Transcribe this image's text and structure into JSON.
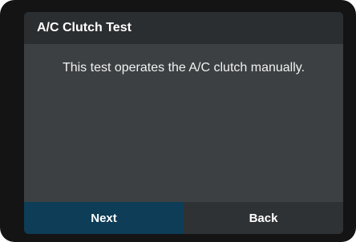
{
  "dialog": {
    "title": "A/C Clutch Test",
    "message": "This test operates the A/C clutch manually.",
    "next_label": "Next",
    "back_label": "Back"
  },
  "colors": {
    "screen_background": "#3c4043",
    "title_bar": "#2b2e30",
    "next_button": "#0d3d57",
    "back_button": "#2f3234",
    "bezel": "#141414"
  }
}
